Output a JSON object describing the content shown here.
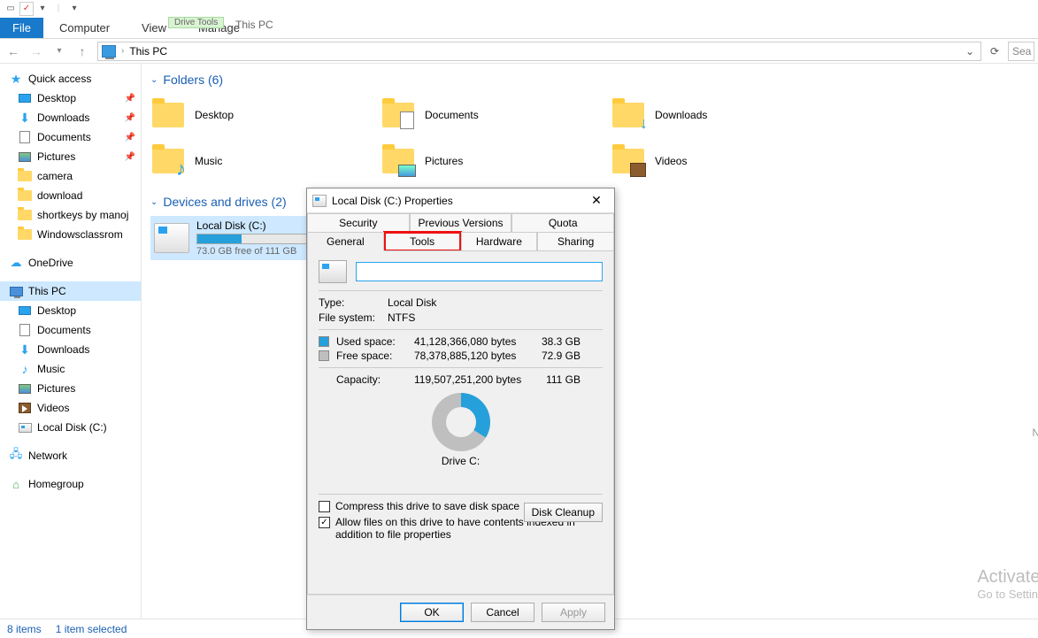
{
  "qa": {
    "checkbox_checked": true
  },
  "ribbon": {
    "file": "File",
    "tabs": [
      "Computer",
      "View"
    ],
    "ctx_group": "Drive Tools",
    "ctx_tab": "Manage",
    "window_title": "This PC"
  },
  "address": {
    "path": "This PC",
    "search_placeholder": "Sea"
  },
  "sidebar": {
    "quick": "Quick access",
    "quick_items": [
      {
        "label": "Desktop",
        "pin": true,
        "ico": "desk"
      },
      {
        "label": "Downloads",
        "pin": true,
        "ico": "dl"
      },
      {
        "label": "Documents",
        "pin": true,
        "ico": "doc"
      },
      {
        "label": "Pictures",
        "pin": true,
        "ico": "pic"
      },
      {
        "label": "camera",
        "pin": false,
        "ico": "folder"
      },
      {
        "label": "download",
        "pin": false,
        "ico": "folder"
      },
      {
        "label": "shortkeys by manoj",
        "pin": false,
        "ico": "folder"
      },
      {
        "label": "Windowsclassrom",
        "pin": false,
        "ico": "folder"
      }
    ],
    "onedrive": "OneDrive",
    "thispc": "This PC",
    "thispc_items": [
      {
        "label": "Desktop",
        "ico": "desk"
      },
      {
        "label": "Documents",
        "ico": "doc"
      },
      {
        "label": "Downloads",
        "ico": "dl"
      },
      {
        "label": "Music",
        "ico": "music"
      },
      {
        "label": "Pictures",
        "ico": "pic"
      },
      {
        "label": "Videos",
        "ico": "vid"
      },
      {
        "label": "Local Disk (C:)",
        "ico": "drive"
      }
    ],
    "network": "Network",
    "homegroup": "Homegroup"
  },
  "content": {
    "folders_hdr": "Folders (6)",
    "folders": [
      {
        "label": "Desktop",
        "badge": ""
      },
      {
        "label": "Documents",
        "badge": "doc"
      },
      {
        "label": "Downloads",
        "badge": "dl"
      },
      {
        "label": "Music",
        "badge": "music"
      },
      {
        "label": "Pictures",
        "badge": "pic"
      },
      {
        "label": "Videos",
        "badge": "vid"
      }
    ],
    "drives_hdr": "Devices and drives (2)",
    "drive": {
      "name": "Local Disk (C:)",
      "sub": "73.0 GB free of 111 GB",
      "fill_pct": 34
    }
  },
  "dialog": {
    "title": "Local Disk (C:) Properties",
    "tabs_row1": [
      "Security",
      "Previous Versions",
      "Quota"
    ],
    "tabs_row2": [
      "General",
      "Tools",
      "Hardware",
      "Sharing"
    ],
    "active_tab": "General",
    "highlight_tab": "Tools",
    "name_value": "",
    "type_k": "Type:",
    "type_v": "Local Disk",
    "fs_k": "File system:",
    "fs_v": "NTFS",
    "used_k": "Used space:",
    "used_bytes": "41,128,366,080 bytes",
    "used_gb": "38.3 GB",
    "free_k": "Free space:",
    "free_bytes": "78,378,885,120 bytes",
    "free_gb": "72.9 GB",
    "cap_k": "Capacity:",
    "cap_bytes": "119,507,251,200 bytes",
    "cap_gb": "111 GB",
    "drive_label": "Drive C:",
    "cleanup": "Disk Cleanup",
    "compress": "Compress this drive to save disk space",
    "index": "Allow files on this drive to have contents indexed in addition to file properties",
    "compress_checked": false,
    "index_checked": true,
    "ok": "OK",
    "cancel": "Cancel",
    "apply": "Apply"
  },
  "status": {
    "items": "8 items",
    "sel": "1 item selected"
  },
  "activate": {
    "t1": "Activate Wir",
    "t2": "Go to Settings to"
  },
  "n_ghost": "N"
}
